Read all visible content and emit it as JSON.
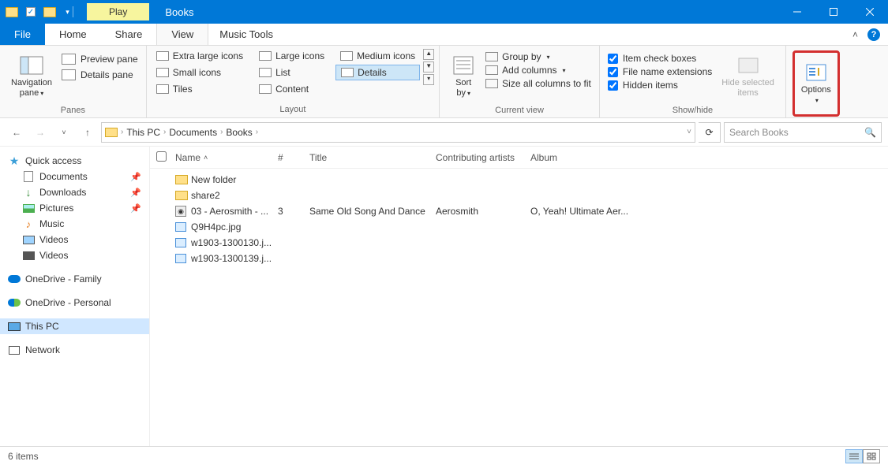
{
  "title": "Books",
  "play_tab": "Play",
  "tabs": {
    "file": "File",
    "home": "Home",
    "share": "Share",
    "view": "View",
    "tools": "Music Tools"
  },
  "ribbon": {
    "panes": {
      "nav": "Navigation\npane",
      "preview": "Preview pane",
      "details": "Details pane",
      "group": "Panes"
    },
    "layout": {
      "xl": "Extra large icons",
      "lg": "Large icons",
      "md": "Medium icons",
      "sm": "Small icons",
      "list": "List",
      "det": "Details",
      "tiles": "Tiles",
      "content": "Content",
      "group": "Layout"
    },
    "currentview": {
      "sortby": "Sort\nby",
      "groupby": "Group by",
      "addcols": "Add columns",
      "sizeall": "Size all columns to fit",
      "group": "Current view"
    },
    "showhide": {
      "itemcheck": "Item check boxes",
      "ext": "File name extensions",
      "hidden": "Hidden items",
      "hidesel": "Hide selected\nitems",
      "group": "Show/hide"
    },
    "options": "Options"
  },
  "breadcrumb": [
    "This PC",
    "Documents",
    "Books"
  ],
  "search_placeholder": "Search Books",
  "nav": {
    "quick": "Quick access",
    "quick_items": [
      "Documents",
      "Downloads",
      "Pictures",
      "Music",
      "Videos"
    ],
    "videos2": "Videos",
    "od_family": "OneDrive - Family",
    "od_personal": "OneDrive - Personal",
    "thispc": "This PC",
    "network": "Network"
  },
  "columns": {
    "name": "Name",
    "num": "#",
    "title": "Title",
    "artists": "Contributing artists",
    "album": "Album"
  },
  "files": [
    {
      "type": "folder",
      "name": "New folder",
      "num": "",
      "title": "",
      "artist": "",
      "album": ""
    },
    {
      "type": "folder",
      "name": "share2",
      "num": "",
      "title": "",
      "artist": "",
      "album": ""
    },
    {
      "type": "music",
      "name": "03 - Aerosmith - ...",
      "num": "3",
      "title": "Same Old Song And Dance",
      "artist": "Aerosmith",
      "album": "O, Yeah! Ultimate Aer..."
    },
    {
      "type": "image",
      "name": "Q9H4pc.jpg",
      "num": "",
      "title": "",
      "artist": "",
      "album": ""
    },
    {
      "type": "image",
      "name": "w1903-1300130.j...",
      "num": "",
      "title": "",
      "artist": "",
      "album": ""
    },
    {
      "type": "image",
      "name": "w1903-1300139.j...",
      "num": "",
      "title": "",
      "artist": "",
      "album": ""
    }
  ],
  "status": "6 items"
}
